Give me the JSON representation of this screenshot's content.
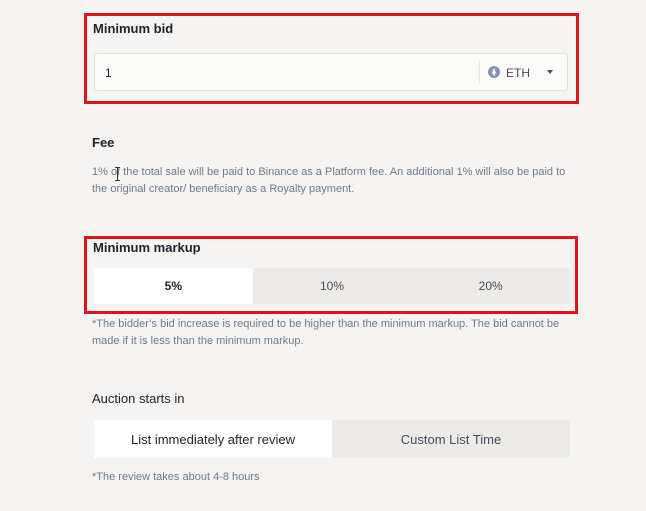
{
  "min_bid": {
    "label": "Minimum bid",
    "value": "1",
    "currency": "ETH",
    "currency_icon": "ethereum-icon"
  },
  "fee": {
    "title": "Fee",
    "description": "1% of the total sale will be paid to Binance as a Platform fee. An additional 1% will also be paid to the original creator/ beneficiary as a Royalty payment."
  },
  "min_markup": {
    "label": "Minimum markup",
    "options": [
      "5%",
      "10%",
      "20%"
    ],
    "selected": "5%",
    "note": "*The bidder’s bid increase is required to be higher than the minimum markup. The bid cannot be made if it is less than the minimum markup."
  },
  "auction": {
    "title": "Auction starts in",
    "options": [
      "List immediately after review",
      "Custom List Time"
    ],
    "selected": "List immediately after review",
    "note": "*The review takes about 4-8 hours"
  },
  "colors": {
    "highlight": "#e0141e",
    "background": "#f5f4f2"
  }
}
